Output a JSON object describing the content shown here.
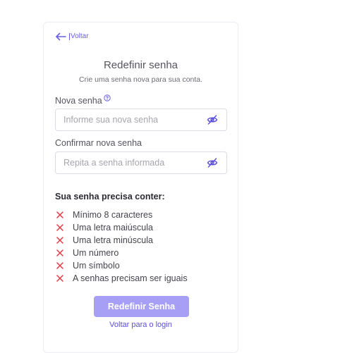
{
  "back": {
    "label": "Voltar"
  },
  "header": {
    "title": "Redefinir senha",
    "subtitle": "Crie uma senha nova para sua conta."
  },
  "new_password": {
    "label": "Nova senha",
    "value": "",
    "placeholder": "Informe sua nova senha",
    "help_icon": "question-circle-icon",
    "toggle_icon": "eye-off-icon"
  },
  "confirm_password": {
    "label": "Confirmar nova senha",
    "value": "",
    "placeholder": "Repita a senha informada",
    "toggle_icon": "eye-off-icon"
  },
  "requirements": {
    "title": "Sua senha precisa conter:",
    "status_icon": "x-icon",
    "status_color": "#e03a45",
    "items": [
      {
        "label": "Mínimo 8 caracteres",
        "met": false
      },
      {
        "label": "Uma letra maiúscula",
        "met": false
      },
      {
        "label": "Uma letra minúscula",
        "met": false
      },
      {
        "label": "Um número",
        "met": false
      },
      {
        "label": "Um símbolo",
        "met": false
      },
      {
        "label": "A senhas precisam ser iguais",
        "met": false
      }
    ]
  },
  "actions": {
    "submit_label": "Redefinir Senha",
    "login_link": "Voltar para o login"
  },
  "colors": {
    "accent": "#6a5fe0",
    "button_disabled": "#a79ff5",
    "error": "#e03a45"
  }
}
